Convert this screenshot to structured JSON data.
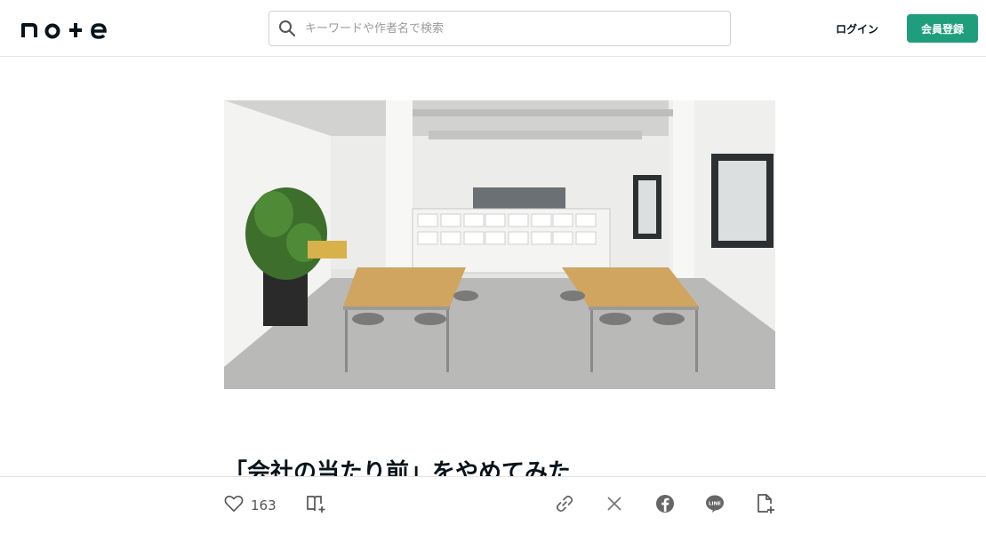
{
  "header": {
    "logo_text": "note",
    "search_placeholder": "キーワードや作者名で検索",
    "login_label": "ログイン",
    "signup_label": "会員登録"
  },
  "article": {
    "title": "「会社の当たり前」をやめてみた"
  },
  "actions": {
    "like_count": "163"
  },
  "colors": {
    "accent": "#1f9e7d",
    "text": "#08131a",
    "icon": "#555555"
  },
  "icons": [
    "search-icon",
    "heart-icon",
    "magazine-add-icon",
    "link-icon",
    "x-icon",
    "facebook-icon",
    "line-icon",
    "add-note-icon"
  ]
}
